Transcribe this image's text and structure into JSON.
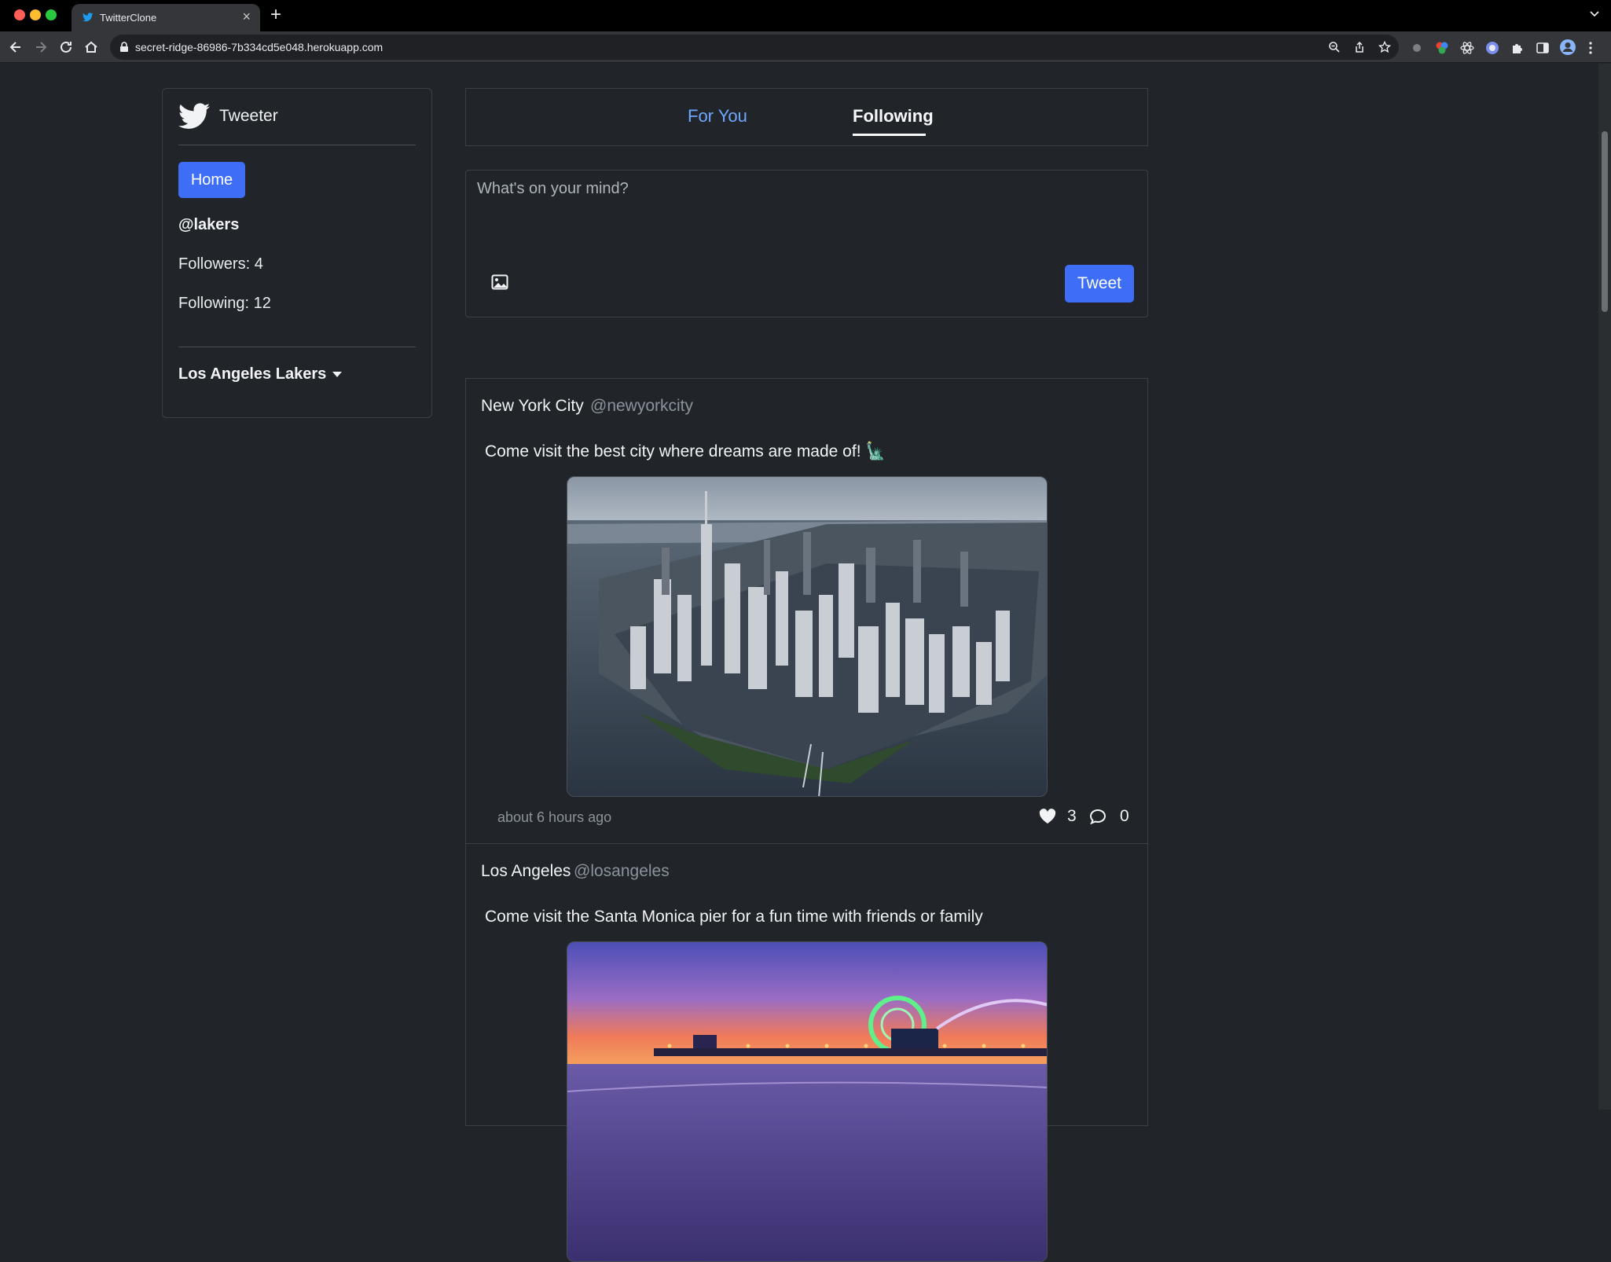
{
  "browser": {
    "tab_title": "TwitterClone",
    "url": "secret-ridge-86986-7b334cd5e048.herokuapp.com"
  },
  "sidebar": {
    "brand": "Tweeter",
    "home_label": "Home",
    "username": "@lakers",
    "followers": "Followers: 4",
    "following": "Following: 12",
    "account_name": "Los Angeles Lakers"
  },
  "feed_tabs": [
    {
      "label": "For You",
      "active": false
    },
    {
      "label": "Following",
      "active": true
    }
  ],
  "composer": {
    "placeholder": "What's on your mind?",
    "tweet_label": "Tweet"
  },
  "posts": [
    {
      "author": "New York City",
      "handle": "@newyorkcity",
      "text": "Come visit the best city where dreams are made of! 🗽",
      "time": "about 6 hours ago",
      "likes": "3",
      "comments": "0",
      "image_desc": "aerial-manhattan-skyline"
    },
    {
      "author": "Los Angeles",
      "handle": "@losangeles",
      "text": "Come visit the Santa Monica pier for a fun time with friends or family",
      "image_desc": "santa-monica-pier-sunset"
    }
  ],
  "colors": {
    "accent": "#3d6ef5",
    "link": "#6ea8fe",
    "background": "#212529"
  }
}
